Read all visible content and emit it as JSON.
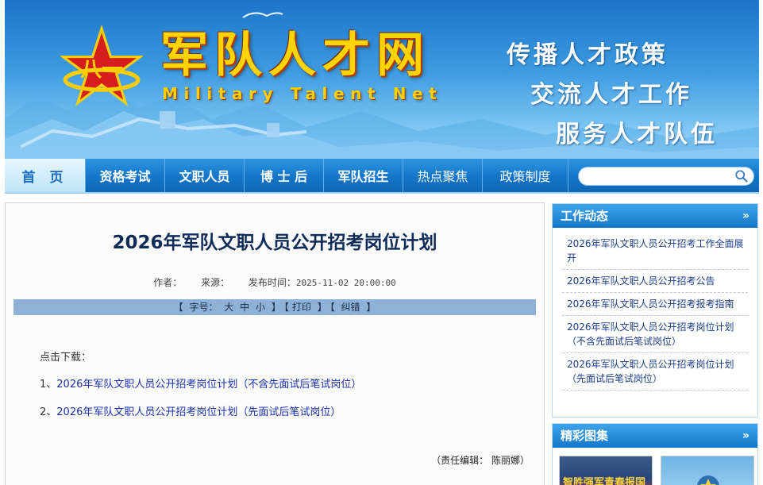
{
  "header": {
    "site_title": "军队人才网",
    "site_subtitle": "Military Talent Net",
    "slogans": [
      "传播人才政策",
      "交流人才工作",
      "服务人才队伍"
    ],
    "icons": {
      "logo": "red-star-logo-icon"
    }
  },
  "nav": {
    "items": [
      {
        "label": "首 页",
        "active": true
      },
      {
        "label": "资格考试"
      },
      {
        "label": "文职人员"
      },
      {
        "label": "博 士 后"
      },
      {
        "label": "军队招生"
      },
      {
        "label": "热点聚焦"
      },
      {
        "label": "政策制度"
      }
    ],
    "search": {
      "placeholder": "",
      "icon": "search-icon"
    }
  },
  "article": {
    "title": "2026年军队文职人员公开招考岗位计划",
    "meta": {
      "author_label": "作者：",
      "source_label": "来源：",
      "time_label": "发布时间：",
      "time_value": "2025-11-02 20:00:00"
    },
    "toolbar": {
      "open1": "【",
      "font_label": "字号：",
      "big": "大",
      "mid": "中",
      "small": "小",
      "close1": "】",
      "open2": "【",
      "print": "打印",
      "close2": "】",
      "open3": "【",
      "error": "纠错",
      "close3": "】"
    },
    "download_label": "点击下载：",
    "downloads": [
      {
        "num": "1、",
        "text": "2026年军队文职人员公开招考岗位计划（不含先面试后笔试岗位）"
      },
      {
        "num": "2、",
        "text": "2026年军队文职人员公开招考岗位计划（先面试后笔试岗位）"
      }
    ],
    "editor": "（责任编辑： 陈丽娜）"
  },
  "sidebar": {
    "work": {
      "title": "工作动态",
      "more": "»",
      "items": [
        "2026年军队文职人员公开招考工作全面展开",
        "2026年军队文职人员公开招考公告",
        "2026年军队文职人员公开招考报考指南",
        "2026年军队文职人员公开招考岗位计划（不含先面试后笔试岗位）",
        "2026年军队文职人员公开招考岗位计划（先面试后笔试岗位）"
      ]
    },
    "gallery": {
      "title": "精彩图集",
      "more": "»",
      "thumb1_text": "智胜强军青春报国"
    }
  },
  "colors": {
    "brand_blue": "#1477c9",
    "title_yellow": "#ffd400",
    "link_blue": "#1a30a8",
    "article_title": "#0f2c58"
  }
}
